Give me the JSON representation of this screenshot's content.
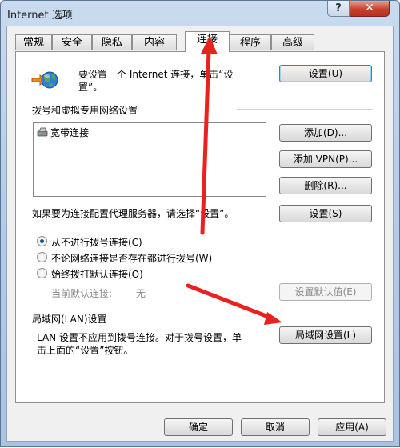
{
  "window": {
    "title": "Internet 选项",
    "help_label": "?",
    "close_label": "✕"
  },
  "tabs": [
    {
      "label": "常规"
    },
    {
      "label": "安全"
    },
    {
      "label": "隐私"
    },
    {
      "label": "内容"
    },
    {
      "label": "连接",
      "active": true
    },
    {
      "label": "程序"
    },
    {
      "label": "高级"
    }
  ],
  "setup": {
    "text_line1": "要设置一个 Internet 连接，单击“设",
    "text_line2": "置”。",
    "button": "设置(U)"
  },
  "dialup": {
    "section_label": "拨号和虚拟专用网络设置",
    "items": [
      {
        "label": "宽带连接"
      }
    ],
    "add_button": "添加(D)...",
    "add_vpn_button": "添加 VPN(P)...",
    "delete_button": "删除(R)...",
    "proxy_text": "如果要为连接配置代理服务器，请选择“设置”。",
    "settings_button": "设置(S)",
    "options": [
      {
        "label": "从不进行拨号连接(C)",
        "checked": true
      },
      {
        "label": "不论网络连接是否存在都进行拨号(W)",
        "checked": false
      },
      {
        "label": "始终拨打默认连接(O)",
        "checked": false
      }
    ],
    "current_default_label": "当前默认连接:",
    "current_default_value": "无",
    "set_default_button": "设置默认值(E)"
  },
  "lan": {
    "section_label": "局域网(LAN)设置",
    "text_line1": "LAN 设置不应用到拨号连接。对于拨号设置，单",
    "text_line2": "击上面的“设置”按钮。",
    "button": "局域网设置(L)"
  },
  "footer": {
    "ok": "确定",
    "cancel": "取消",
    "apply": "应用(A)"
  },
  "colors": {
    "annotation_arrow": "#e8231f",
    "default_button_border": "#3c7fb1"
  }
}
